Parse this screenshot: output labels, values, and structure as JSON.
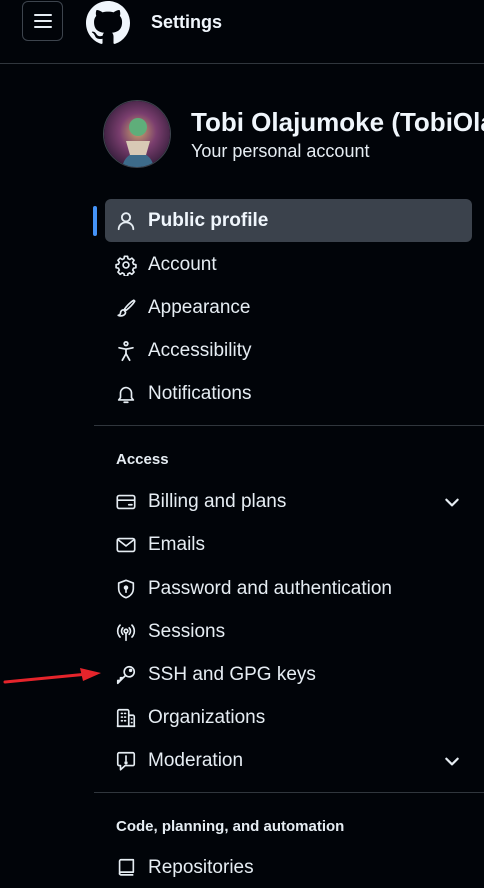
{
  "header": {
    "title": "Settings"
  },
  "user": {
    "name": "Tobi Olajumoke (TobiOla",
    "subtitle": "Your personal account"
  },
  "nav": {
    "public_profile": "Public profile",
    "account": "Account",
    "appearance": "Appearance",
    "accessibility": "Accessibility",
    "notifications": "Notifications"
  },
  "access": {
    "heading": "Access",
    "billing": "Billing and plans",
    "emails": "Emails",
    "password": "Password and authentication",
    "sessions": "Sessions",
    "ssh": "SSH and GPG keys",
    "organizations": "Organizations",
    "moderation": "Moderation"
  },
  "code_section": {
    "heading": "Code, planning, and automation",
    "repositories": "Repositories"
  },
  "colors": {
    "accent": "#4493f8",
    "annotation_arrow": "#e5242b",
    "background": "#010409"
  }
}
